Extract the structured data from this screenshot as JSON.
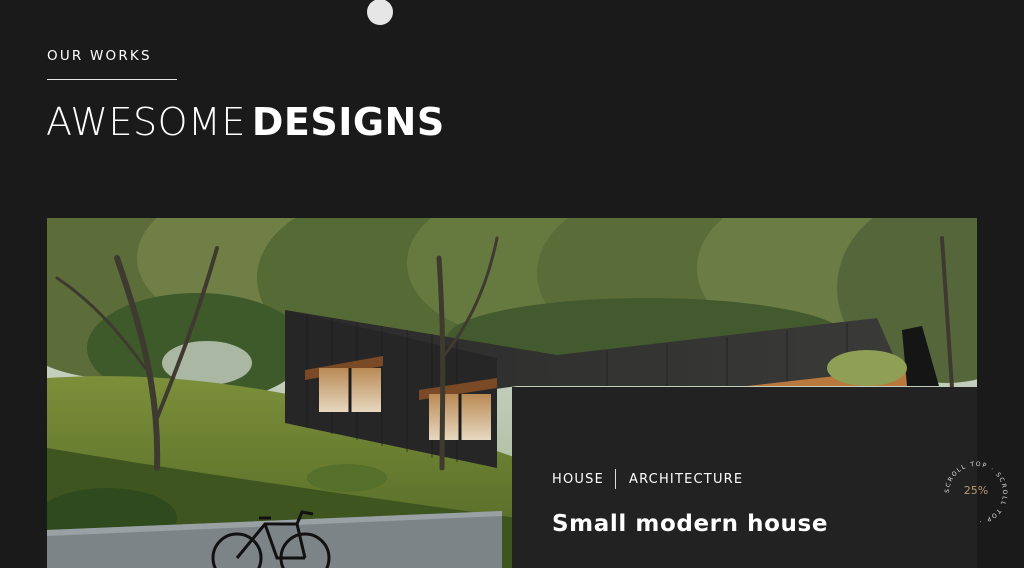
{
  "section": {
    "eyebrow": "OUR WORKS",
    "heading_light": "AWESOME",
    "heading_bold": "DESIGNS"
  },
  "project": {
    "tags": [
      "HOUSE",
      "ARCHITECTURE"
    ],
    "title": "Small modern house",
    "image": "modern-forest-house-photo"
  },
  "scroll_top": {
    "ring_text": "SCROLL TOP · SCROLL TOP · ",
    "progress_label": "25%",
    "progress": 0.25,
    "accent_color": "#b89a73"
  },
  "colors": {
    "background": "#1a1a1a",
    "card": "#222222",
    "text": "#ffffff"
  }
}
